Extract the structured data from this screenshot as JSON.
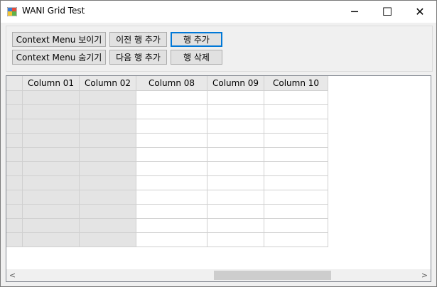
{
  "window": {
    "title": "WANI Grid Test",
    "controls": {
      "minimize": "─",
      "maximize": "☐",
      "close": "✕"
    }
  },
  "toolbar": {
    "show_context_menu": "Context Menu 보이기",
    "hide_context_menu": "Context Menu 숨기기",
    "insert_prev_row": "이전 행 추가",
    "insert_next_row": "다음 행 추가",
    "add_row": "행 추가",
    "delete_row": "행 삭제"
  },
  "grid": {
    "columns": [
      "Column 01",
      "Column 02",
      "Column 08",
      "Column 09",
      "Column 10"
    ],
    "readonly_columns": [
      "Column 01",
      "Column 02"
    ],
    "row_count": 11
  },
  "scrollbar": {
    "left_arrow": "<",
    "right_arrow": ">"
  },
  "colors": {
    "accent": "#0078d7",
    "readonly_cell": "#e4e4e4",
    "header": "#e8e8e8"
  }
}
